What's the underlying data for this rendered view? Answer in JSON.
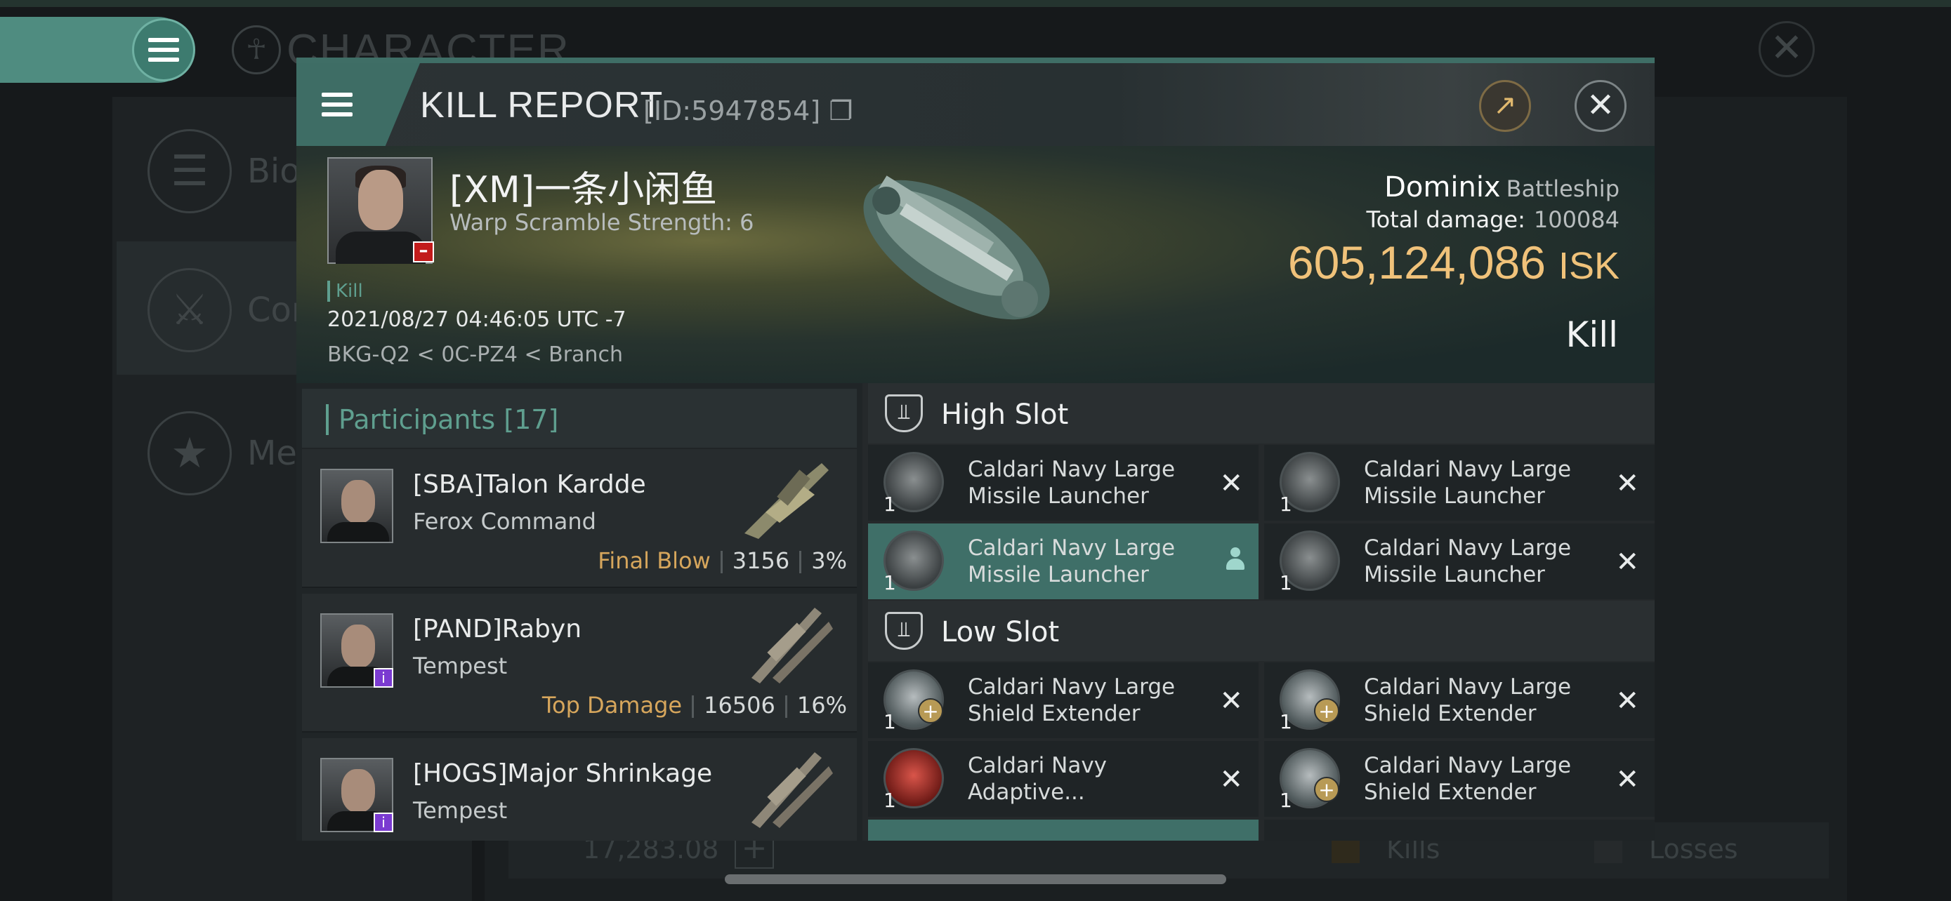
{
  "background": {
    "title": "CHARACTER",
    "sidebar": [
      {
        "label": "Bio",
        "icon": "menu-icon"
      },
      {
        "label": "Com",
        "icon": "combat-icon"
      },
      {
        "label": "Med",
        "icon": "medal-icon"
      }
    ],
    "bottom": {
      "isk_value": "17,283.08",
      "kills_label": "Kills",
      "losses_label": "Losses"
    }
  },
  "dialog": {
    "title": "KILL REPORT",
    "id_label": "[ID:5947854]",
    "victim": {
      "name": "[XM]一条小闲鱼",
      "warp_scramble": "Warp Scramble Strength: 6",
      "tag": "Kill",
      "datetime": "2021/08/27 04:46:05 UTC -7",
      "location": "BKG-Q2 < 0C-PZ4 < Branch",
      "ship_name": "Dominix",
      "ship_class": "Battleship",
      "total_damage_label": "Total damage:",
      "total_damage_value": "100084",
      "isk_value": "605,124,086",
      "isk_unit": "ISK",
      "result": "Kill"
    },
    "participants": {
      "header": "Participants [17]",
      "rows": [
        {
          "name": "[SBA]Talon Kardde",
          "ship": "Ferox Command",
          "role": "Final Blow",
          "damage": "3156",
          "percent": "3%"
        },
        {
          "name": "[PAND]Rabyn",
          "ship": "Tempest",
          "role": "Top Damage",
          "damage": "16506",
          "percent": "16%"
        },
        {
          "name": "[HOGS]Major Shrinkage",
          "ship": "Tempest",
          "role": "",
          "damage": "",
          "percent": ""
        }
      ]
    },
    "fitting": {
      "high_slot": {
        "label": "High Slot",
        "modules": [
          {
            "name": "Caldari Navy Large Missile Launcher",
            "qty": "1"
          },
          {
            "name": "Caldari Navy Large Missile Launcher",
            "qty": "1"
          },
          {
            "name": "Caldari Navy Large Missile Launcher",
            "qty": "1"
          },
          {
            "name": "Caldari Navy Large Missile Launcher",
            "qty": "1"
          }
        ]
      },
      "low_slot": {
        "label": "Low Slot",
        "modules": [
          {
            "name": "Caldari Navy Large Shield Extender",
            "qty": "1"
          },
          {
            "name": "Caldari Navy Large Shield Extender",
            "qty": "1"
          },
          {
            "name": "Caldari Navy Adaptive...",
            "qty": "1"
          },
          {
            "name": "Caldari Navy Large Shield Extender",
            "qty": "1"
          }
        ]
      }
    }
  }
}
